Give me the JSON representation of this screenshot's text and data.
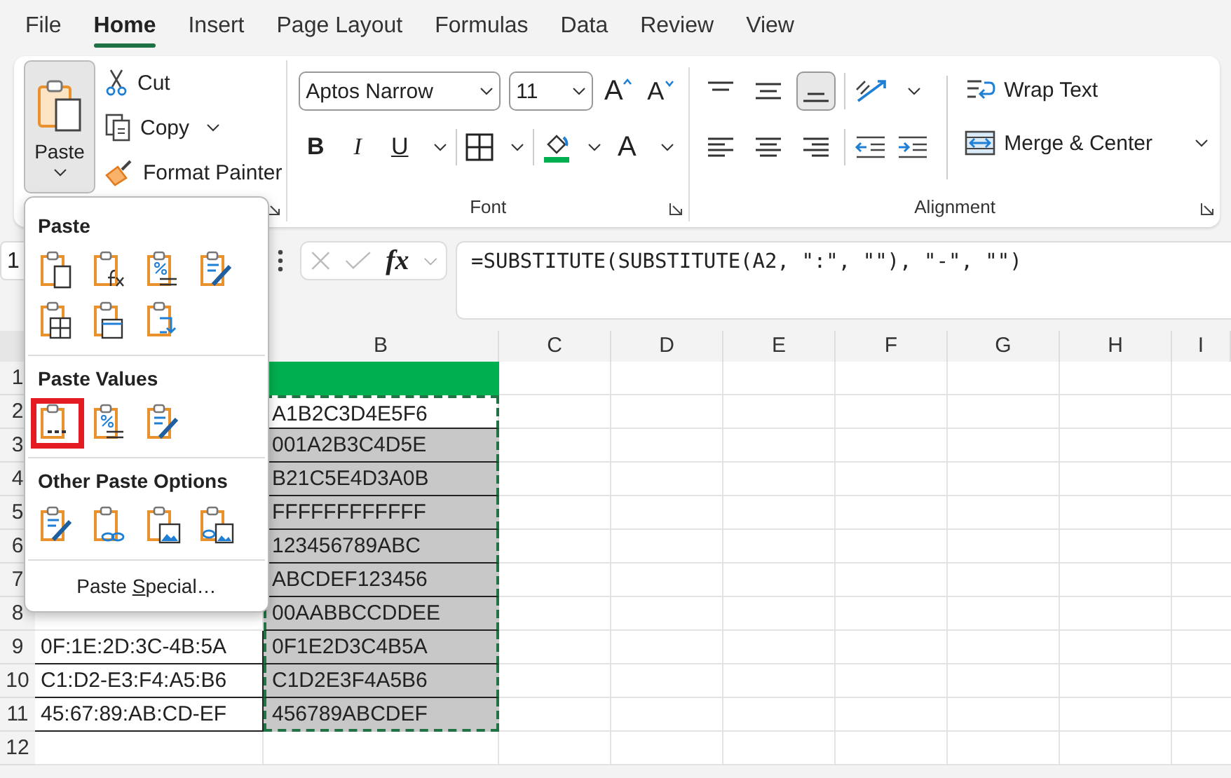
{
  "tabs": [
    {
      "label": "File",
      "selected": false
    },
    {
      "label": "Home",
      "selected": true
    },
    {
      "label": "Insert",
      "selected": false
    },
    {
      "label": "Page Layout",
      "selected": false
    },
    {
      "label": "Formulas",
      "selected": false
    },
    {
      "label": "Data",
      "selected": false
    },
    {
      "label": "Review",
      "selected": false
    },
    {
      "label": "View",
      "selected": false
    }
  ],
  "clipboard": {
    "paste": "Paste",
    "cut": "Cut",
    "copy": "Copy",
    "format_painter": "Format Painter"
  },
  "font": {
    "name": "Aptos Narrow",
    "size": "11",
    "grow": "A",
    "shrink": "A",
    "bold": "B",
    "italic": "I",
    "underline": "U",
    "font_color_letter": "A",
    "label": "Font"
  },
  "alignment": {
    "vertical": [
      {
        "kind": "top",
        "selected": false
      },
      {
        "kind": "middle",
        "selected": false
      },
      {
        "kind": "bottom",
        "selected": true
      }
    ],
    "horizontal": [
      {
        "kind": "left"
      },
      {
        "kind": "center"
      },
      {
        "kind": "right"
      }
    ],
    "wrap_text": "Wrap Text",
    "merge_center": "Merge & Center",
    "label": "Alignment"
  },
  "name_box": "1",
  "formula_bar": {
    "fx": "fx",
    "formula": "=SUBSTITUTE(SUBSTITUTE(A2, \":\", \"\"), \"-\", \"\")"
  },
  "sheet": {
    "columns": [
      "B",
      "C",
      "D",
      "E",
      "F",
      "G",
      "H",
      "I"
    ],
    "rows": [
      {
        "number": "1",
        "filled": true,
        "selected": false,
        "shaded": false
      },
      {
        "number": "2",
        "b": "A1B2C3D4E5F6",
        "filled": false,
        "selected": true,
        "shaded": false
      },
      {
        "number": "3",
        "b": "001A2B3C4D5E",
        "filled": false,
        "selected": true,
        "shaded": true
      },
      {
        "number": "4",
        "b": "B21C5E4D3A0B",
        "filled": false,
        "selected": true,
        "shaded": true
      },
      {
        "number": "5",
        "b": "FFFFFFFFFFFF",
        "filled": false,
        "selected": true,
        "shaded": true
      },
      {
        "number": "6",
        "b": "123456789ABC",
        "filled": false,
        "selected": true,
        "shaded": true
      },
      {
        "number": "7",
        "b": "ABCDEF123456",
        "filled": false,
        "selected": true,
        "shaded": true
      },
      {
        "number": "8",
        "b": "00AABBCCDDEE",
        "filled": false,
        "selected": true,
        "shaded": true
      },
      {
        "number": "9",
        "a": "0F:1E:2D:3C-4B:5A",
        "b": "0F1E2D3C4B5A",
        "filled": false,
        "selected": true,
        "shaded": true
      },
      {
        "number": "10",
        "a": "C1:D2-E3:F4:A5:B6",
        "b": "C1D2E3F4A5B6",
        "filled": false,
        "selected": true,
        "shaded": true
      },
      {
        "number": "11",
        "a": "45:67:89:AB:CD-EF",
        "b": "456789ABCDEF",
        "filled": false,
        "selected": true,
        "shaded": true
      },
      {
        "number": "12",
        "filled": false,
        "selected": false,
        "shaded": false
      }
    ]
  },
  "paste_menu": {
    "sections": [
      {
        "title": "Paste",
        "items": [
          {
            "kind": "paste",
            "selected": false
          },
          {
            "kind": "formulas",
            "selected": false
          },
          {
            "kind": "formulas-number",
            "selected": false
          },
          {
            "kind": "keep-source",
            "selected": false
          },
          {
            "kind": "no-borders",
            "selected": false
          },
          {
            "kind": "column-widths",
            "selected": false
          },
          {
            "kind": "transpose",
            "selected": false
          }
        ]
      },
      {
        "title": "Paste Values",
        "items": [
          {
            "kind": "values",
            "selected": true
          },
          {
            "kind": "values-number",
            "selected": false
          },
          {
            "kind": "values-source",
            "selected": false
          }
        ]
      },
      {
        "title": "Other Paste Options",
        "items": [
          {
            "kind": "formatting",
            "selected": false
          },
          {
            "kind": "link",
            "selected": false
          },
          {
            "kind": "picture",
            "selected": false
          },
          {
            "kind": "linked-picture",
            "selected": false
          }
        ]
      }
    ],
    "paste_special": {
      "before": "Paste ",
      "access_key": "S",
      "after": "pecial…"
    }
  }
}
